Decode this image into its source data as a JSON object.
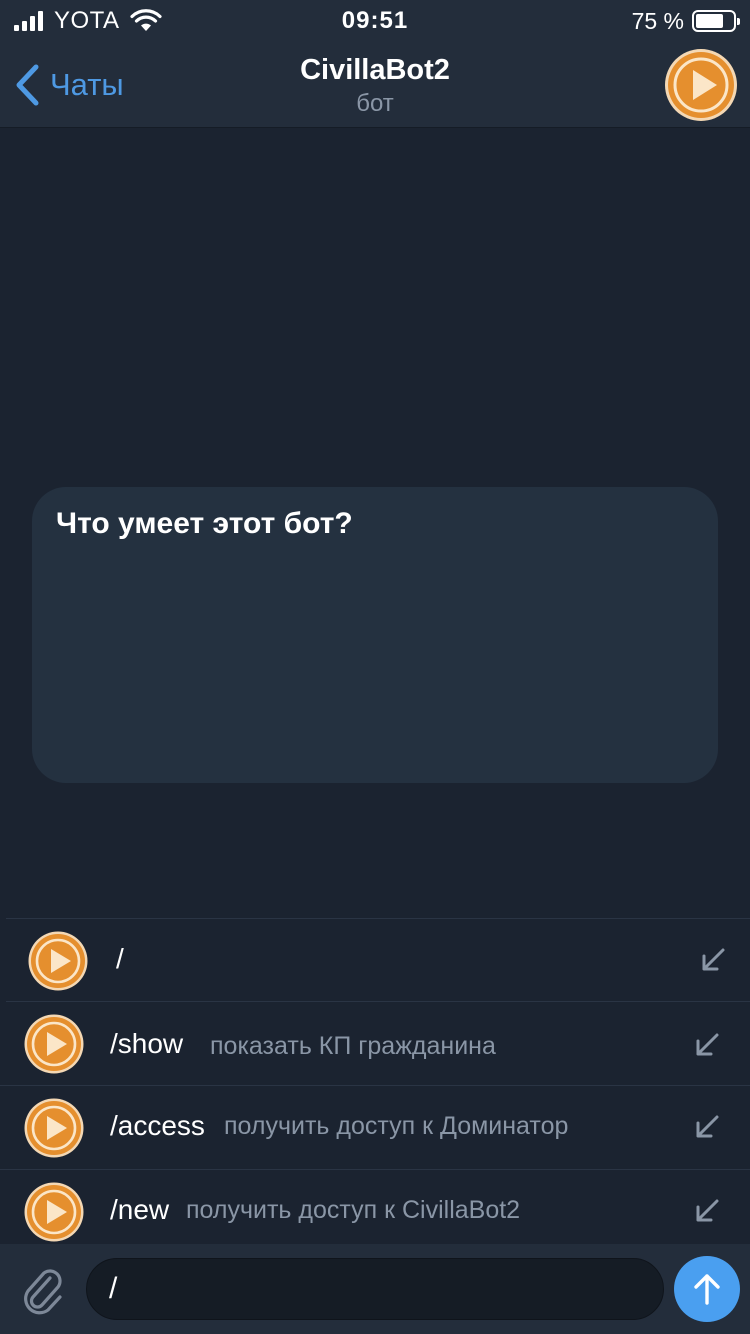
{
  "status_bar": {
    "carrier": "YOTA",
    "time": "09:51",
    "battery_text": "75 %",
    "battery_level": 0.75,
    "icons": [
      "signal-icon",
      "wifi-icon",
      "battery-icon"
    ]
  },
  "header": {
    "back_label": "Чаты",
    "title": "CivillaBot2",
    "subtitle": "бот",
    "avatar_icon": "play-icon"
  },
  "chat": {
    "info_card_title": "Что умеет этот бот?"
  },
  "commands": [
    {
      "name": "/",
      "description": ""
    },
    {
      "name": "/show",
      "description": "показать КП гражданина"
    },
    {
      "name": "/access",
      "description": "получить доступ к Доминатор"
    },
    {
      "name": "/new",
      "description": "получить доступ к CivillaBot2"
    }
  ],
  "input": {
    "value": "/",
    "attach_icon": "paperclip-icon",
    "send_icon": "arrow-up-icon"
  },
  "colors": {
    "accent": "#4e99e3",
    "send_button": "#4a9ff0",
    "background": "#1b2330",
    "bar": "#232d3b",
    "card": "#243140",
    "avatar": "#e58f2e"
  }
}
